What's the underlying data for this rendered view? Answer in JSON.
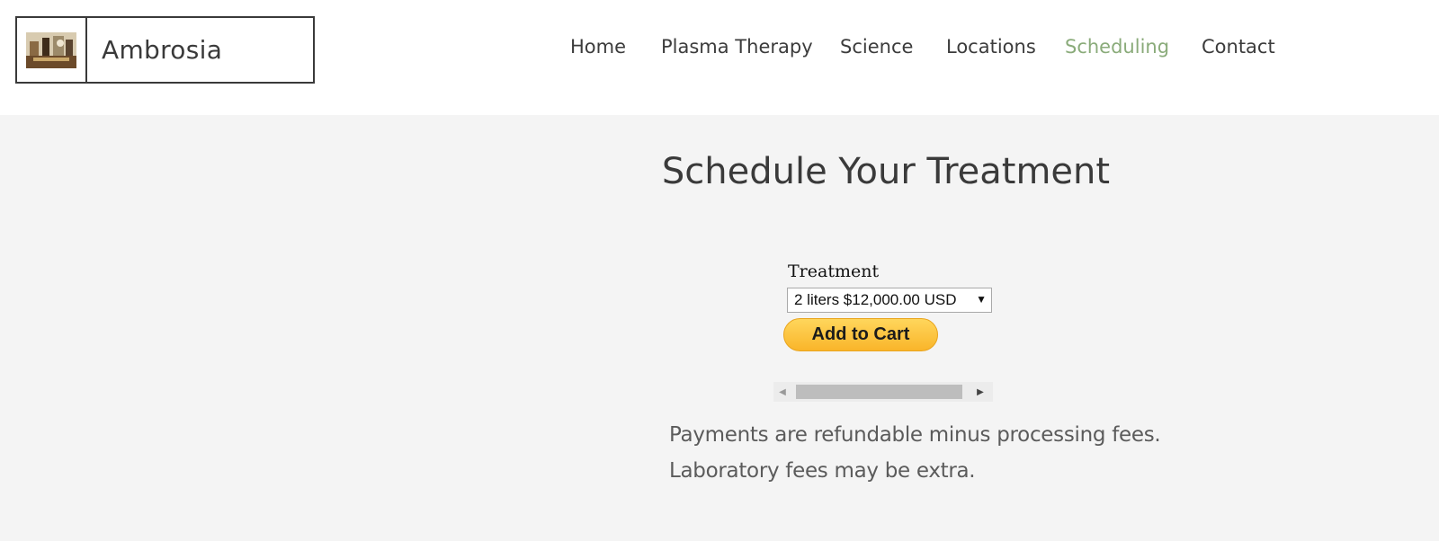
{
  "header": {
    "site_name": "Ambrosia",
    "logo_icon": "site-logo-image"
  },
  "nav": {
    "items": [
      {
        "label": "Home"
      },
      {
        "label": "Plasma Therapy"
      },
      {
        "label": "Science"
      },
      {
        "label": "Locations"
      },
      {
        "label": "Scheduling",
        "active": true
      },
      {
        "label": "Contact"
      }
    ],
    "active_color": "#8aab7a"
  },
  "main": {
    "title": "Schedule Your Treatment",
    "form": {
      "field_label": "Treatment",
      "selected_option": "2 liters $12,000.00 USD",
      "add_to_cart_label": "Add to Cart"
    },
    "notes": [
      "Payments are refundable minus processing fees.",
      "Laboratory fees may be extra."
    ]
  },
  "colors": {
    "background": "#f4f4f4",
    "header_background": "#ffffff",
    "button_yellow": "#f9b52a"
  }
}
